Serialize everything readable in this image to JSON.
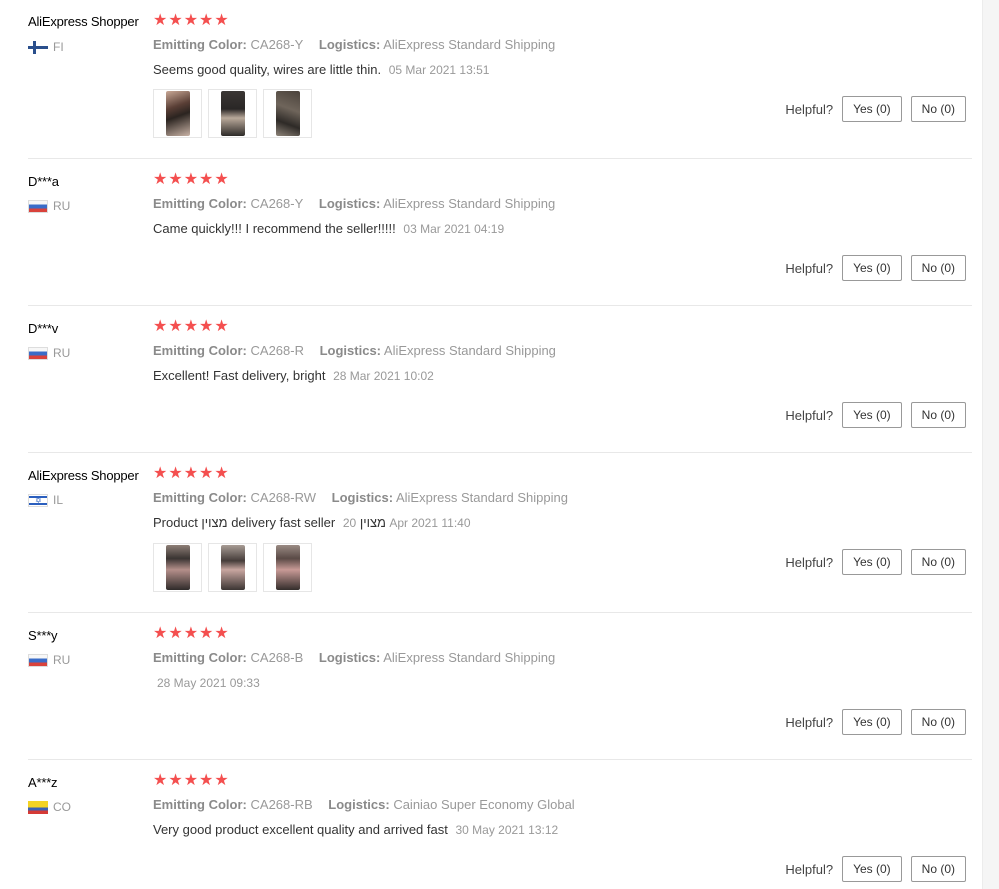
{
  "helpful_label": "Helpful?",
  "star_glyphs": "★★★★★",
  "colors": {
    "star": "#f44f4f",
    "divider": "#e8e8e8"
  },
  "reviews": [
    {
      "user": "AliExpress Shopper",
      "country": "FI",
      "rating": 5,
      "emitting_label": "Emitting Color:",
      "emitting_value": "CA268-Y",
      "logistics_label": "Logistics:",
      "logistics_value": "AliExpress Standard Shipping",
      "comment": "Seems good quality, wires are little thin.",
      "date": "05 Mar 2021 13:51",
      "photos": 3,
      "yes": "Yes (0)",
      "no": "No (0)"
    },
    {
      "user": "D***a",
      "country": "RU",
      "rating": 5,
      "emitting_label": "Emitting Color:",
      "emitting_value": "CA268-Y",
      "logistics_label": "Logistics:",
      "logistics_value": "AliExpress Standard Shipping",
      "comment": "Came quickly!!! I recommend the seller!!!!!",
      "date": "03 Mar 2021 04:19",
      "photos": 0,
      "yes": "Yes (0)",
      "no": "No (0)"
    },
    {
      "user": "D***v",
      "country": "RU",
      "rating": 5,
      "emitting_label": "Emitting Color:",
      "emitting_value": "CA268-R",
      "logistics_label": "Logistics:",
      "logistics_value": "AliExpress Standard Shipping",
      "comment": "Excellent! Fast delivery, bright",
      "date": "28 Mar 2021 10:02",
      "photos": 0,
      "yes": "Yes (0)",
      "no": "No (0)"
    },
    {
      "user": "AliExpress Shopper",
      "country": "IL",
      "rating": 5,
      "emitting_label": "Emitting Color:",
      "emitting_value": "CA268-RW",
      "logistics_label": "Logistics:",
      "logistics_value": "AliExpress Standard Shipping",
      "comment": "Product מצוין delivery fast seller מצוין",
      "date": "20 Apr 2021 11:40",
      "photos": 3,
      "yes": "Yes (0)",
      "no": "No (0)"
    },
    {
      "user": "S***y",
      "country": "RU",
      "rating": 5,
      "emitting_label": "Emitting Color:",
      "emitting_value": "CA268-B",
      "logistics_label": "Logistics:",
      "logistics_value": "AliExpress Standard Shipping",
      "comment": "",
      "date": "28 May 2021 09:33",
      "photos": 0,
      "yes": "Yes (0)",
      "no": "No (0)"
    },
    {
      "user": "A***z",
      "country": "CO",
      "rating": 5,
      "emitting_label": "Emitting Color:",
      "emitting_value": "CA268-RB",
      "logistics_label": "Logistics:",
      "logistics_value": "Cainiao Super Economy Global",
      "comment": "Very good product excellent quality and arrived fast",
      "date": "30 May 2021 13:12",
      "photos": 0,
      "yes": "Yes (0)",
      "no": "No (0)"
    }
  ]
}
